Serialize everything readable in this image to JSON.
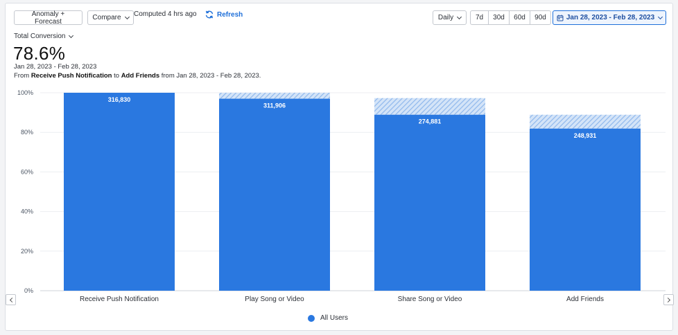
{
  "toolbar": {
    "anomaly_label": "Anomaly + Forecast",
    "compare_label": "Compare",
    "computed_text": "Computed 4 hrs ago",
    "refresh_label": "Refresh",
    "interval_label": "Daily",
    "ranges": [
      "7d",
      "30d",
      "60d",
      "90d"
    ],
    "date_range": "Jan 28, 2023 - Feb 28, 2023"
  },
  "summary": {
    "metric_label": "Total Conversion",
    "value": "78.6%",
    "period": "Jan 28, 2023 - Feb 28, 2023",
    "desc_from": "From ",
    "desc_start": "Receive Push Notification",
    "desc_to": " to ",
    "desc_end": "Add Friends",
    "desc_tail": " from Jan 28, 2023 - Feb 28, 2023."
  },
  "chart_data": {
    "type": "bar",
    "categories": [
      "Receive Push Notification",
      "Play Song or Video",
      "Share Song or Video",
      "Add Friends"
    ],
    "series": [
      {
        "name": "All Users",
        "values": [
          100,
          97.0,
          88.9,
          81.9
        ],
        "counts": [
          "316,830",
          "311,906",
          "274,881",
          "248,931"
        ],
        "forecast_top": [
          100,
          100,
          97.3,
          88.9
        ]
      }
    ],
    "ylim": [
      0,
      100
    ],
    "yticks": [
      "0%",
      "20%",
      "40%",
      "60%",
      "80%",
      "100%"
    ],
    "ytick_values": [
      0,
      20,
      40,
      60,
      80,
      100
    ],
    "grid": true,
    "legend": "bottom-center",
    "bar_color": "#2a78e0",
    "forecast_color": "#a9c8f1"
  },
  "legend": {
    "label": "All Users"
  }
}
